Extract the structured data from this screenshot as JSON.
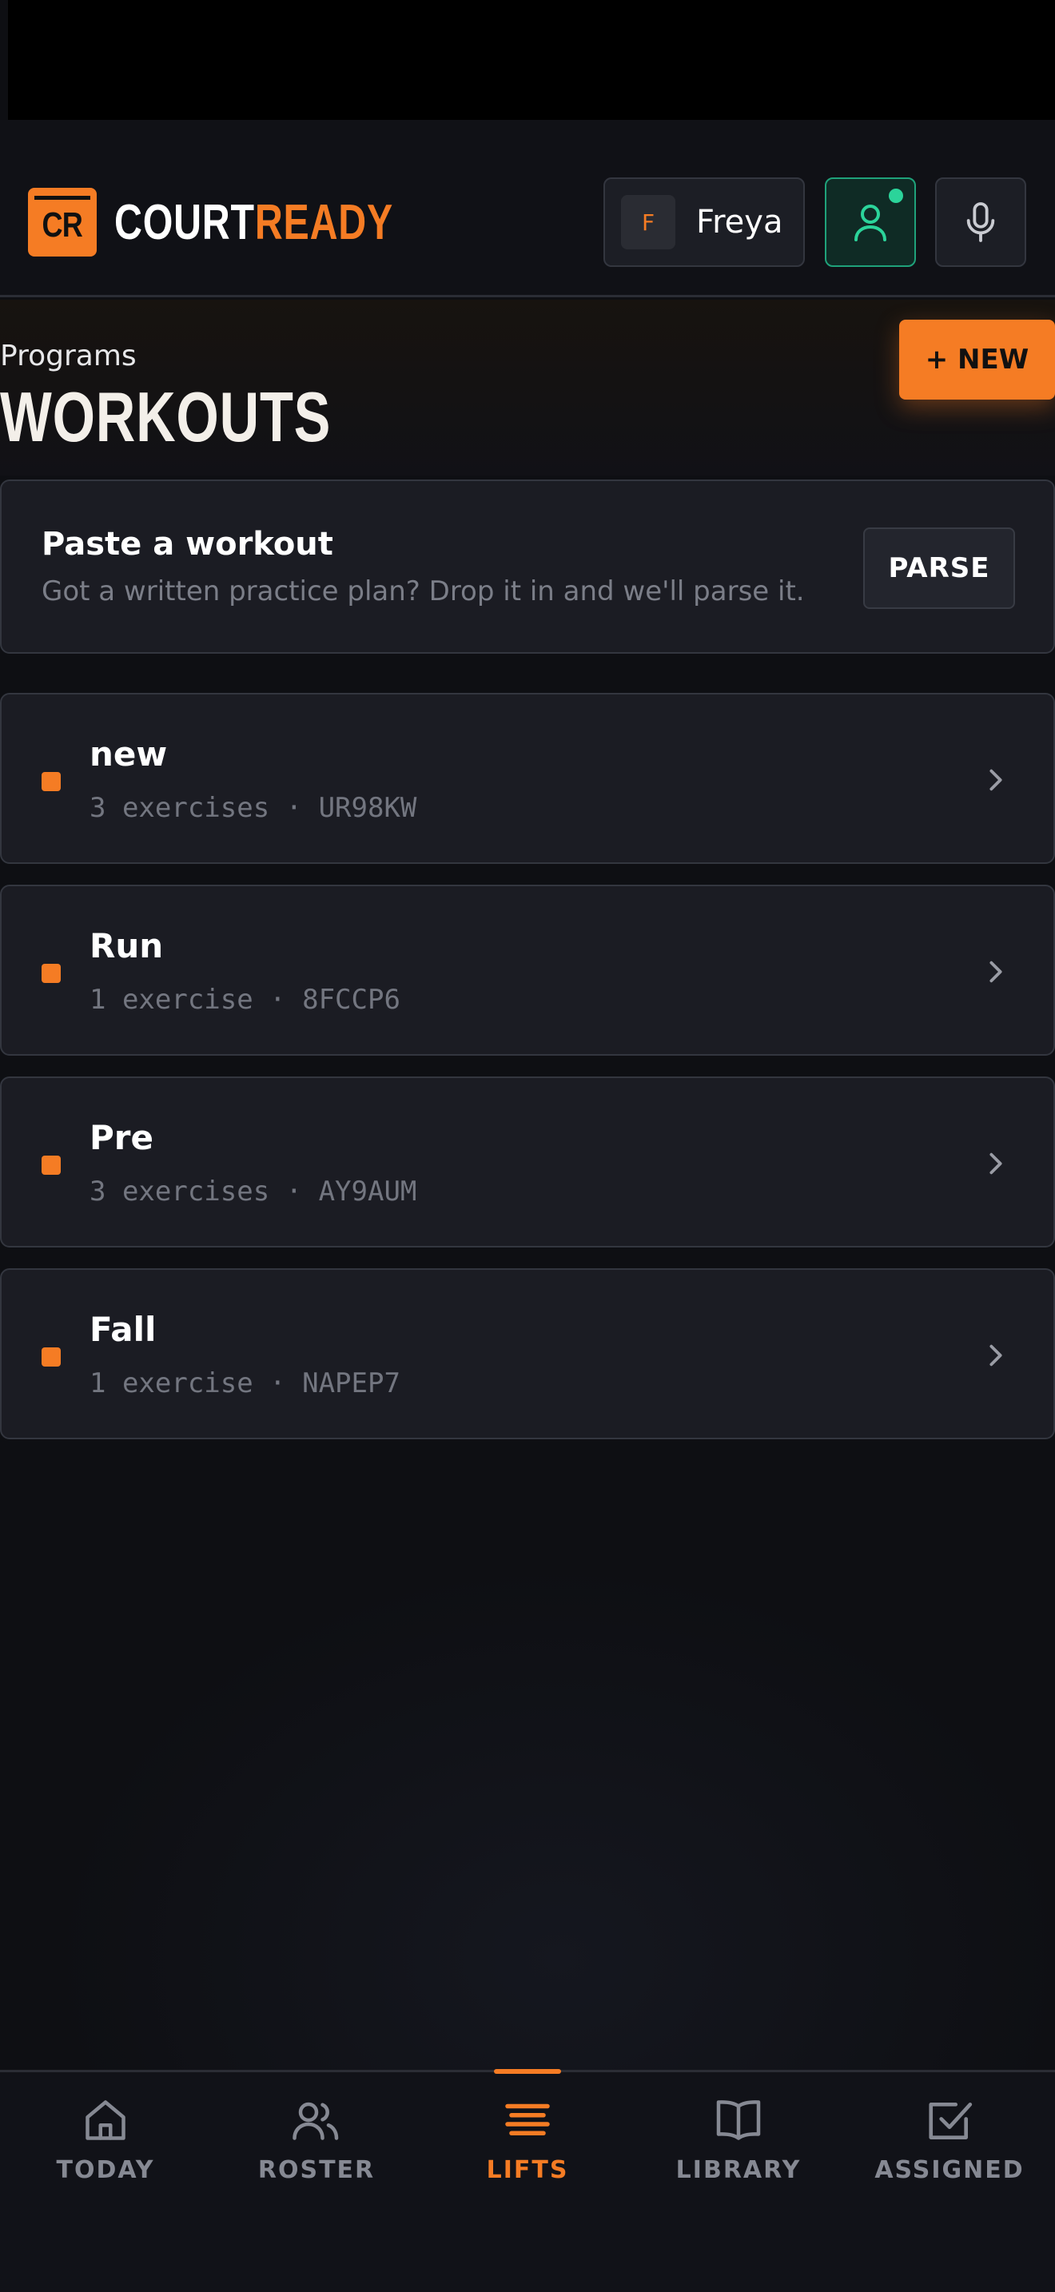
{
  "header": {
    "logo_badge": "CR",
    "logo_word_1": "COURT",
    "logo_word_2": "READY",
    "user": {
      "initial": "F",
      "name": "Freya"
    },
    "icons": {
      "profile": "user-icon",
      "mic": "microphone-icon"
    },
    "colors": {
      "accent": "#f57c24",
      "online": "#2bd49a"
    }
  },
  "title_section": {
    "eyebrow": "Programs",
    "title": "WORKOUTS",
    "new_button": "+ NEW"
  },
  "paste_card": {
    "title": "Paste a workout",
    "subtitle": "Got a written practice plan? Drop it in and we'll parse it.",
    "button": "PARSE"
  },
  "workouts": [
    {
      "name": "new",
      "meta": "3 exercises · UR98KW"
    },
    {
      "name": "Run",
      "meta": "1 exercise · 8FCCP6"
    },
    {
      "name": "Pre",
      "meta": "3 exercises · AY9AUM"
    },
    {
      "name": "Fall",
      "meta": "1 exercise · NAPEP7"
    }
  ],
  "nav": {
    "items": [
      {
        "label": "TODAY",
        "icon": "home-icon"
      },
      {
        "label": "ROSTER",
        "icon": "users-icon"
      },
      {
        "label": "LIFTS",
        "icon": "lifts-icon",
        "active": true
      },
      {
        "label": "LIBRARY",
        "icon": "book-icon"
      },
      {
        "label": "ASSIGNED",
        "icon": "checkbox-icon"
      }
    ]
  }
}
